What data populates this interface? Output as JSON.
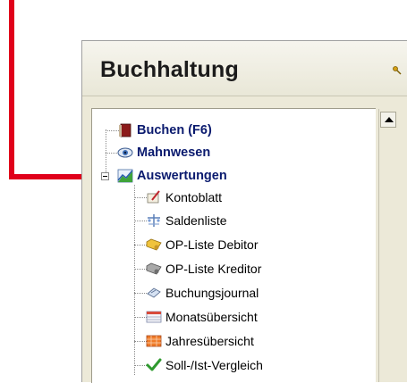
{
  "window": {
    "title": "Buchhaltung"
  },
  "tree": {
    "top_items": [
      {
        "label": "Buchen (F6)",
        "icon": "book-icon"
      },
      {
        "label": "Mahnwesen",
        "icon": "eye-icon"
      },
      {
        "label": "Auswertungen",
        "icon": "chart-icon",
        "expanded": true
      }
    ],
    "sub_items": [
      {
        "label": "Kontoblatt",
        "icon": "ledger-pen-icon"
      },
      {
        "label": "Saldenliste",
        "icon": "balance-icon"
      },
      {
        "label": "OP-Liste Debitor",
        "icon": "debtor-folder-icon"
      },
      {
        "label": "OP-Liste Kreditor",
        "icon": "creditor-folder-icon"
      },
      {
        "label": "Buchungsjournal",
        "icon": "journal-icon"
      },
      {
        "label": "Monatsübersicht",
        "icon": "month-table-icon"
      },
      {
        "label": "Jahresübersicht",
        "icon": "year-table-icon"
      },
      {
        "label": "Soll-/Ist-Vergleich",
        "icon": "checkmark-icon"
      }
    ]
  },
  "colors": {
    "annotation_arrow": "#e0001a",
    "top_item_text": "#0a1a6e"
  }
}
